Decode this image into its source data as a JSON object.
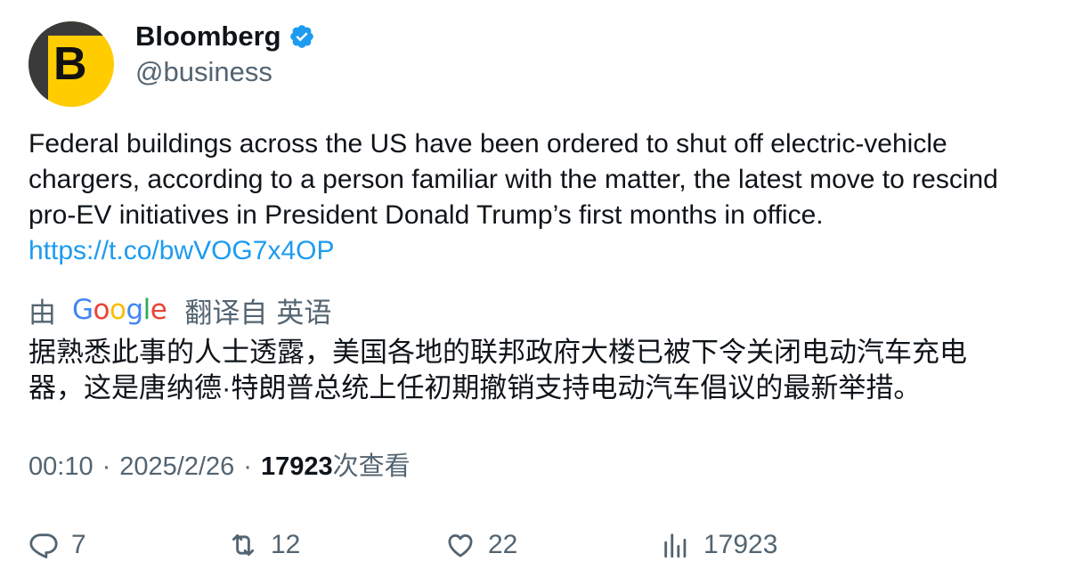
{
  "author": {
    "avatar_letter": "B",
    "display_name": "Bloomberg",
    "handle": "@business",
    "verified": true
  },
  "tweet": {
    "text": "Federal buildings across the US have been ordered to shut off electric-vehicle chargers, according to a person familiar with the matter, the latest move to rescind pro-EV initiatives in President Donald Trump’s first months in office.",
    "link": "https://t.co/bwVOG7x4OP"
  },
  "translation": {
    "by_label": "由",
    "provider": [
      "G",
      "o",
      "o",
      "g",
      "l",
      "e"
    ],
    "translated_from_label": "翻译自",
    "source_language": "英语",
    "text": "据熟悉此事的人士透露，美国各地的联邦政府大楼已被下令关闭电动汽车充电器，这是唐纳德·特朗普总统上任初期撤销支持电动汽车倡议的最新举措。"
  },
  "meta": {
    "time": "00:10",
    "separator": "·",
    "date": "2025/2/26",
    "views_count": "17923",
    "views_label": "次查看"
  },
  "actions": {
    "replies": "7",
    "retweets": "12",
    "likes": "22",
    "views": "17923"
  },
  "colors": {
    "accent": "#1d9bf0",
    "secondary_text": "#536471",
    "avatar_yellow": "#ffcc00"
  }
}
